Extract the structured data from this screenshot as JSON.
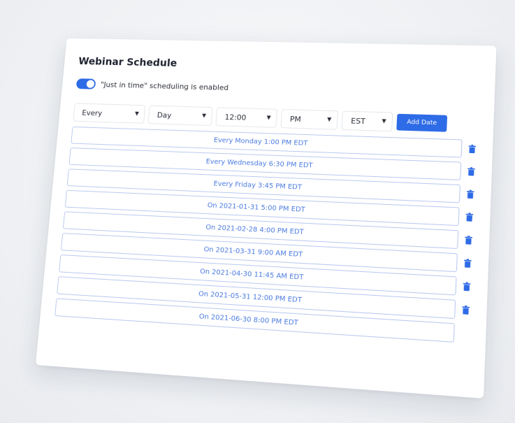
{
  "panel": {
    "title": "Webinar Schedule",
    "toggle": {
      "label": "\"Just in time\" scheduling is enabled",
      "enabled": true
    }
  },
  "controls": {
    "frequency": "Every",
    "period": "Day",
    "time": "12:00",
    "ampm": "PM",
    "timezone": "EST",
    "add_label": "Add Date"
  },
  "schedule": [
    "Every Monday 1:00 PM EDT",
    "Every Wednesday 6:30 PM EDT",
    "Every Friday 3:45 PM EDT",
    "On 2021-01-31 5:00 PM EDT",
    "On 2021-02-28 4:00 PM EDT",
    "On 2021-03-31 9:00 AM EDT",
    "On 2021-04-30 11:45 AM EDT",
    "On 2021-05-31 12:00 PM EDT",
    "On 2021-06-30 8:00 PM EDT"
  ],
  "colors": {
    "accent": "#2e6be6",
    "pill_text": "#4a7be0",
    "pill_border": "#b8c8ee"
  },
  "icons": {
    "select_caret": "chevron-down-icon",
    "delete": "trash-icon"
  }
}
